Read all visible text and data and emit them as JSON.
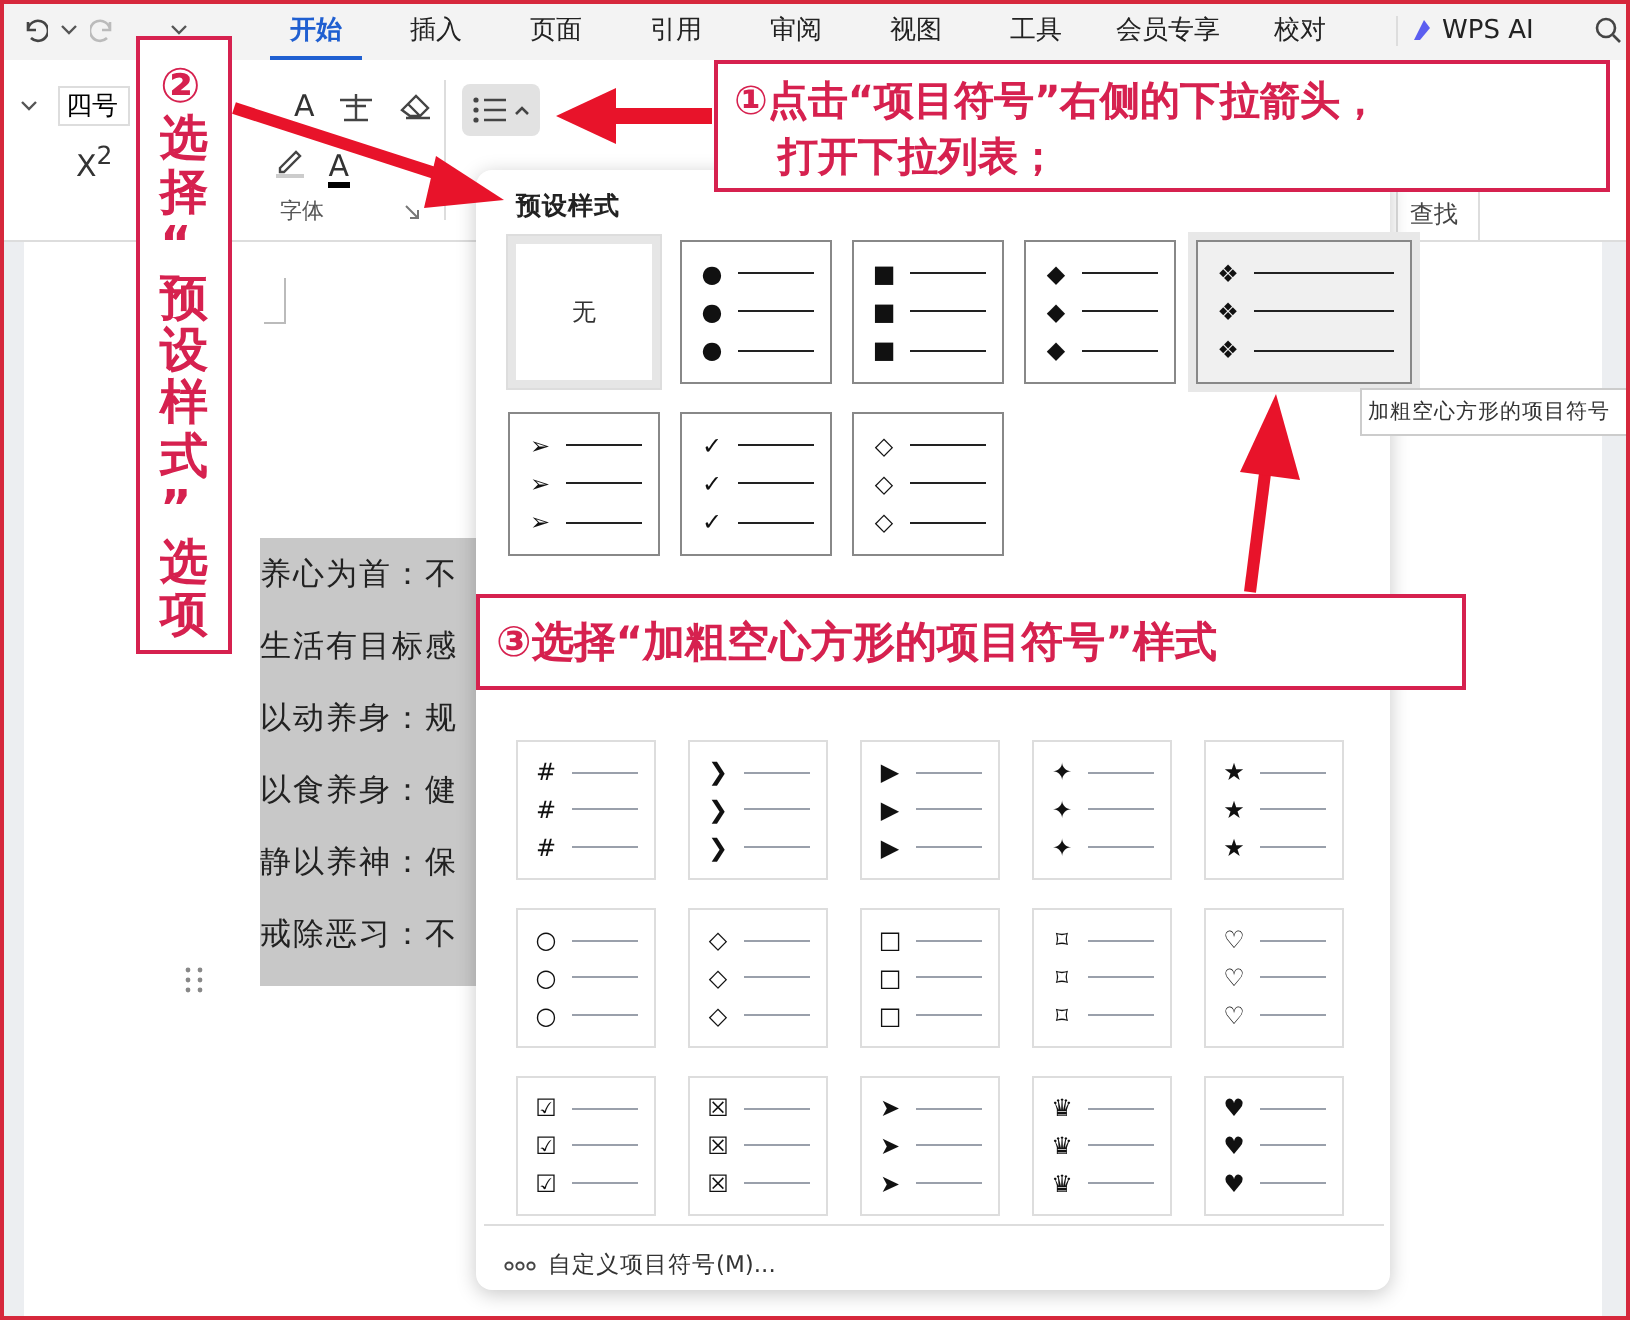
{
  "tabs": [
    {
      "label": "开始",
      "selected": true
    },
    {
      "label": "插入",
      "selected": false
    },
    {
      "label": "页面",
      "selected": false
    },
    {
      "label": "引用",
      "selected": false
    },
    {
      "label": "审阅",
      "selected": false
    },
    {
      "label": "视图",
      "selected": false
    },
    {
      "label": "工具",
      "selected": false
    },
    {
      "label": "会员专享",
      "selected": false
    },
    {
      "label": "校对",
      "selected": false
    }
  ],
  "ai_tab": {
    "label": "WPS AI"
  },
  "ribbon": {
    "font_size": "四号",
    "grow_font": "A",
    "superscript": "X$^{2}$",
    "font_color": "A",
    "group_label": "字体",
    "find_label": "查找"
  },
  "document": {
    "lines": [
      "养心为首：不",
      "生活有目标感",
      "以动养身：规",
      "以食养身：健",
      "静以养神：保",
      "戒除恶习：不"
    ]
  },
  "bullet_menu": {
    "section_title": "预设样式",
    "presets": [
      {
        "kind": "none",
        "label": "无",
        "current": true,
        "selected": false
      },
      {
        "kind": "bullets",
        "bullets": [
          "●",
          "●",
          "●"
        ],
        "current": false,
        "selected": false
      },
      {
        "kind": "bullets",
        "bullets": [
          "■",
          "■",
          "■"
        ],
        "current": false,
        "selected": false
      },
      {
        "kind": "bullets",
        "bullets": [
          "◆",
          "◆",
          "◆"
        ],
        "current": false,
        "selected": false
      },
      {
        "kind": "bullets",
        "bullets": [
          "❖",
          "❖",
          "❖"
        ],
        "current": false,
        "selected": true
      },
      {
        "kind": "bullets",
        "bullets": [
          "➢",
          "➢",
          "➢"
        ],
        "current": false,
        "selected": false
      },
      {
        "kind": "bullets",
        "bullets": [
          "✓",
          "✓",
          "✓"
        ],
        "current": false,
        "selected": false
      },
      {
        "kind": "bullets",
        "bullets": [
          "◇",
          "◇",
          "◇"
        ],
        "current": false,
        "selected": false
      }
    ],
    "library": [
      {
        "bullets": [
          "#",
          "#",
          "#"
        ]
      },
      {
        "bullets": [
          "❯",
          "❯",
          "❯"
        ]
      },
      {
        "bullets": [
          "▶",
          "▶",
          "▶"
        ]
      },
      {
        "bullets": [
          "✦",
          "✦",
          "✦"
        ]
      },
      {
        "bullets": [
          "★",
          "★",
          "★"
        ]
      },
      {
        "bullets": [
          "○",
          "○",
          "○"
        ]
      },
      {
        "bullets": [
          "◇",
          "◇",
          "◇"
        ]
      },
      {
        "bullets": [
          "□",
          "□",
          "□"
        ]
      },
      {
        "bullets": [
          "⌑",
          "⌑",
          "⌑"
        ]
      },
      {
        "bullets": [
          "♡",
          "♡",
          "♡"
        ]
      },
      {
        "bullets": [
          "☑",
          "☑",
          "☑"
        ]
      },
      {
        "bullets": [
          "☒",
          "☒",
          "☒"
        ]
      },
      {
        "bullets": [
          "➤",
          "➤",
          "➤"
        ]
      },
      {
        "bullets": [
          "♛",
          "♛",
          "♛"
        ]
      },
      {
        "bullets": [
          "♥",
          "♥",
          "♥"
        ]
      }
    ],
    "custom": {
      "label": "自定义项目符号(M)..."
    }
  },
  "tooltip": {
    "text": "加粗空心方形的项目符号"
  },
  "annotations": [
    {
      "kind": "vertical",
      "lines": [
        "②选择“预设样式”选项"
      ]
    },
    {
      "kind": "box",
      "lines": [
        "①点击“项目符号”右侧的下拉箭头，",
        "打开下拉列表；"
      ]
    },
    {
      "kind": "box",
      "lines": [
        "③选择“加粗空心方形的项目符号”样式"
      ]
    }
  ]
}
